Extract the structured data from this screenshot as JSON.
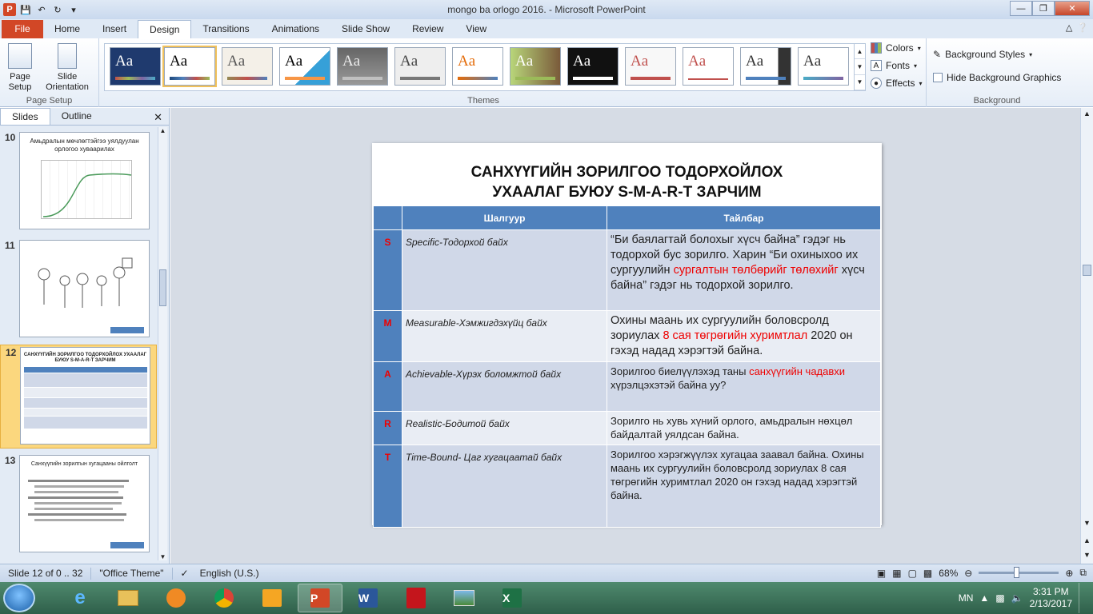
{
  "window": {
    "title": "mongo ba orlogo 2016.  -  Microsoft PowerPoint"
  },
  "tabs": [
    "File",
    "Home",
    "Insert",
    "Design",
    "Transitions",
    "Animations",
    "Slide Show",
    "Review",
    "View"
  ],
  "ribbon": {
    "page_setup": {
      "btn1": "Page Setup",
      "btn2": "Slide Orientation",
      "label": "Page Setup"
    },
    "themes": {
      "label": "Themes",
      "sample": "Aa"
    },
    "theme_options": {
      "colors": "Colors",
      "fonts": "Fonts",
      "effects": "Effects"
    },
    "background": {
      "styles": "Background Styles",
      "hide": "Hide Background Graphics",
      "label": "Background"
    }
  },
  "left_pane": {
    "tab_slides": "Slides",
    "tab_outline": "Outline",
    "thumbs": [
      {
        "num": "10",
        "title": "Амьдралын мөчлөгтэйгээ уялдуулан орлогоо хуваарилах"
      },
      {
        "num": "11",
        "title": ""
      },
      {
        "num": "12",
        "title": "САНХҮҮГИЙН ЗОРИЛГОО ТОДОРХОЙЛОХ УХААЛАГ БУЮУ S-M-A-R-T ЗАРЧИМ"
      },
      {
        "num": "13",
        "title": "Санхүүгийн зорилгын хугацааны ойлголт"
      }
    ]
  },
  "slide": {
    "title_line1": "САНХҮҮГИЙН ЗОРИЛГОО ТОДОРХОЙЛОХ",
    "title_line2": "УХААЛАГ  БУЮУ S-M-A-R-T  ЗАРЧИМ",
    "header_criterion": "Шалгуур",
    "header_description": "Тайлбар",
    "rows": [
      {
        "letter": "S",
        "criterion": "Specific-Тодорхой  байх",
        "desc_a": "“Би баялагтай болохыг хүсч байна” гэдэг нь тодорхой бус зорилго.  Харин “Би охиныхоо их сургуулийн ",
        "desc_red": "сургалтын төлбөрийг төлөхийг",
        "desc_b": "  хүсч байна” гэдэг нь тодорхой зорилго."
      },
      {
        "letter": "M",
        "criterion": "Measurable-Хэмжигдэхүйц  байх",
        "desc_a": "Охины маань их сургуулийн  боловсролд зориулах ",
        "desc_red": "8 сая төгрөгийн хуримтлал",
        "desc_b": "  2020 он гэхэд надад хэрэгтэй  байна."
      },
      {
        "letter": "A",
        "criterion": "Achievable-Хүрэх  боломжтой байх",
        "desc_a": "Зорилгоо биелүүлэхэд  таны ",
        "desc_red": "санхүүгийн чадавхи",
        "desc_b": " хүрэлцэхэтэй байна уу?"
      },
      {
        "letter": "R",
        "criterion": "Realistic-Бодитой  байх",
        "desc_a": "Зорилго нь хувь хүний орлого, амьдралын нөхцөл байдалтай уялдсан байна.",
        "desc_red": "",
        "desc_b": ""
      },
      {
        "letter": "T",
        "criterion": "Time-Bound-  Цаг хугацаатай  байх",
        "desc_a": "Зорилгоо хэрэгжүүлэх  хугацаа заавал байна. Охины маань их сургуулийн боловсролд зориулах 8 сая төгрөгийн хуримтлал 2020 он гэхэд надад хэрэгтэй  байна.",
        "desc_red": "",
        "desc_b": ""
      }
    ]
  },
  "status": {
    "slide_info": "Slide 12 of 0 .. 32",
    "theme": "\"Office Theme\"",
    "language": "English (U.S.)",
    "zoom": "68%"
  },
  "taskbar": {
    "lang": "MN",
    "time": "3:31 PM",
    "date": "2/13/2017"
  },
  "colors": {
    "accent": "#4f81bd",
    "file_tab": "#d24726",
    "highlight_red": "#ee0000"
  }
}
